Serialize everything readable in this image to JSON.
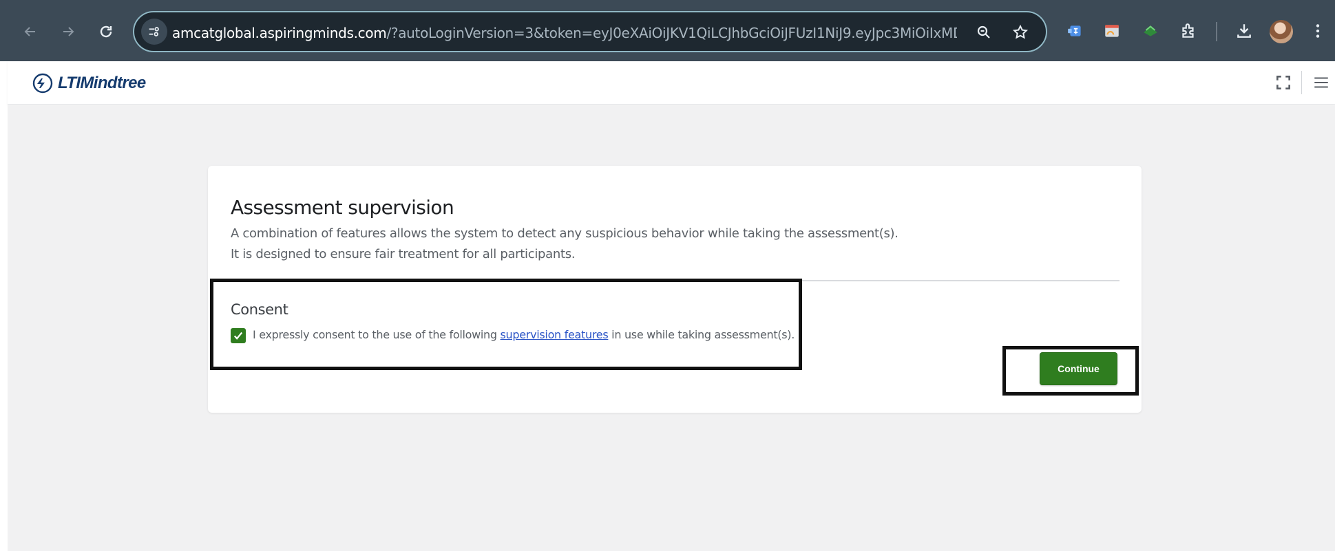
{
  "browser": {
    "url_host": "amcatglobal.aspiringminds.com",
    "url_path": "/?autoLoginVersion=3&token=eyJ0eXAiOiJKV1QiLCJhbGciOiJFUzI1NiJ9.eyJpc3MiOiIxMDA...",
    "icons": [
      "back-arrow-icon",
      "forward-arrow-icon",
      "reload-icon",
      "site-info-icon",
      "zoom-icon",
      "bookmark-star-icon",
      "extension-icon",
      "download-icon",
      "more-menu-icon"
    ]
  },
  "header": {
    "logo_text": "LTIMindtree",
    "brand_color": "#153b6e"
  },
  "card": {
    "title": "Assessment supervision",
    "description_line1": "A combination of features allows the system to detect any suspicious behavior while taking the assessment(s).",
    "description_line2": "It is designed to ensure fair treatment for all participants."
  },
  "consent": {
    "title": "Consent",
    "checked": true,
    "text_before": "I expressly consent to the use of the following ",
    "link_text": "supervision features",
    "text_after": " in use while taking assessment(s)."
  },
  "actions": {
    "continue_label": "Continue",
    "accent_color": "#2f7d1f"
  }
}
